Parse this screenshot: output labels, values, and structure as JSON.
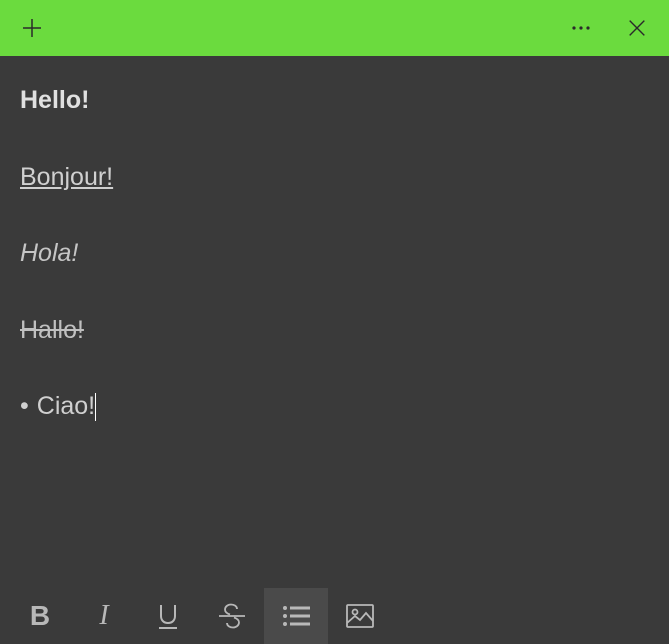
{
  "titlebar": {
    "accent_color": "#6bdb3e"
  },
  "note": {
    "lines": [
      {
        "text": "Hello!",
        "style": "bold"
      },
      {
        "text": "Bonjour!",
        "style": "underline"
      },
      {
        "text": "Hola!",
        "style": "italic"
      },
      {
        "text": "Hallo!",
        "style": "strike"
      },
      {
        "text": "Ciao!",
        "style": "bullet",
        "cursor": true
      }
    ]
  },
  "toolbar": {
    "bold_label": "B",
    "italic_label": "I",
    "underline_label": "U",
    "active": "bullets"
  }
}
